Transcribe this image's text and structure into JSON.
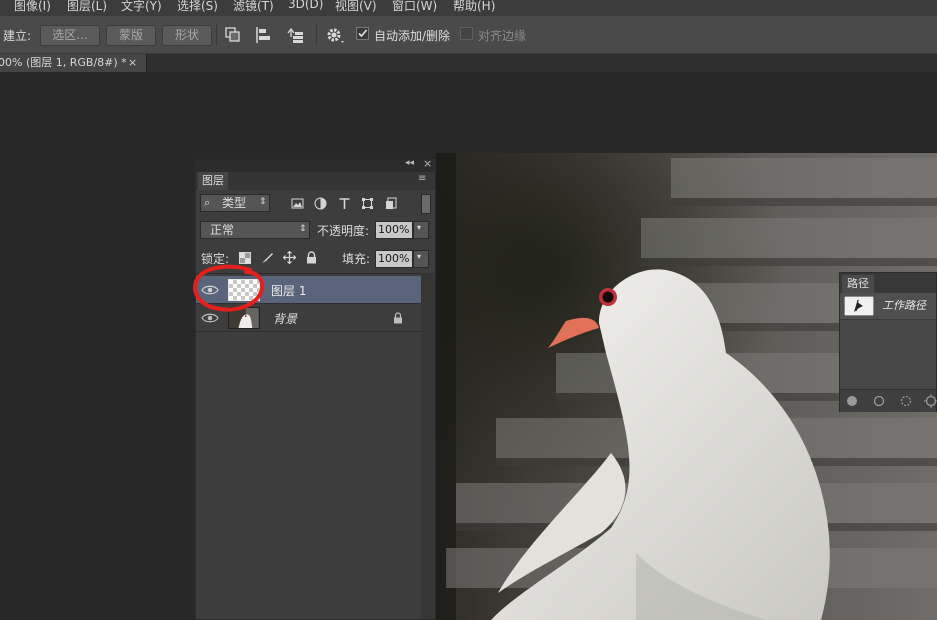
{
  "menubar": {
    "items": [
      "图像(I)",
      "图层(L)",
      "文字(Y)",
      "选择(S)",
      "滤镜(T)",
      "3D(D)",
      "视图(V)",
      "窗口(W)",
      "帮助(H)"
    ]
  },
  "options_bar": {
    "make_label": "建立:",
    "selection_button": "选区...",
    "mask_button": "蒙版",
    "shape_button": "形状",
    "auto_add_delete_label": "自动添加/删除",
    "auto_add_delete_checked": true,
    "align_edges_label": "对齐边缘",
    "align_edges_checked": false
  },
  "document_tab": {
    "title": "00% (图层 1, RGB/8#) *",
    "close": "×"
  },
  "layers_panel": {
    "tab_label": "图层",
    "filter_kind": "类型",
    "blend_mode": "正常",
    "opacity_label": "不透明度:",
    "opacity_value": "100%",
    "lock_label": "锁定:",
    "fill_label": "填充:",
    "fill_value": "100%",
    "layers": [
      {
        "name": "图层 1",
        "selected": true
      },
      {
        "name": "背景",
        "selected": false,
        "locked": true
      }
    ]
  },
  "paths_panel": {
    "tab_label": "路径",
    "items": [
      {
        "name": "工作路径"
      }
    ]
  },
  "colors": {
    "selection_highlight": "#59647a",
    "annotation_circle": "#e4201e"
  }
}
